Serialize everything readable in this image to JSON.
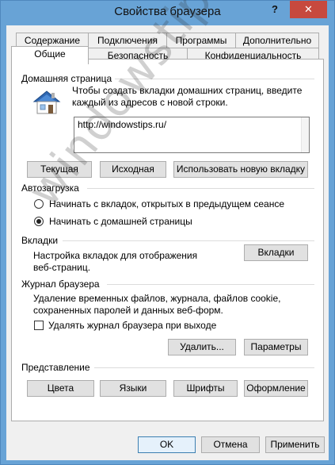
{
  "window": {
    "title": "Свойства браузера",
    "help_glyph": "?",
    "close_glyph": "✕"
  },
  "tabs": {
    "row1": [
      "Содержание",
      "Подключения",
      "Программы",
      "Дополнительно"
    ],
    "row2": [
      "Общие",
      "Безопасность",
      "Конфиденциальность"
    ],
    "active": "Общие"
  },
  "homepage": {
    "group_title": "Домашняя страница",
    "description": [
      "Чтобы создать вкладки домашних страниц, введите",
      "каждый из адресов с новой строки."
    ],
    "url": "http://windowstips.ru/",
    "btn_current": "Текущая",
    "btn_default": "Исходная",
    "btn_new_tab": "Использовать новую вкладку"
  },
  "startup": {
    "group_title": "Автозагрузка",
    "option1": "Начинать с вкладок, открытых в предыдущем сеансе",
    "option2": "Начинать с домашней страницы",
    "selected": "option2"
  },
  "tabs_group": {
    "group_title": "Вкладки",
    "description": [
      "Настройка вкладок для отображения",
      "веб-страниц."
    ],
    "btn_tabs": "Вкладки"
  },
  "history": {
    "group_title": "Журнал браузера",
    "description": [
      "Удаление временных файлов, журнала, файлов cookie,",
      "сохраненных паролей и данных веб-форм."
    ],
    "checkbox_label": "Удалять журнал браузера при выходе",
    "checkbox_checked": false,
    "btn_delete": "Удалить...",
    "btn_params": "Параметры"
  },
  "appearance": {
    "group_title": "Представление",
    "btn_colors": "Цвета",
    "btn_languages": "Языки",
    "btn_fonts": "Шрифты",
    "btn_design": "Оформление"
  },
  "footer": {
    "btn_ok": "OK",
    "btn_cancel": "Отмена",
    "btn_apply": "Применить"
  },
  "watermark": "windowstips.ru",
  "colors": {
    "frame": "#68a3d6",
    "close": "#c7493e",
    "dialog": "#f0f0f0"
  }
}
